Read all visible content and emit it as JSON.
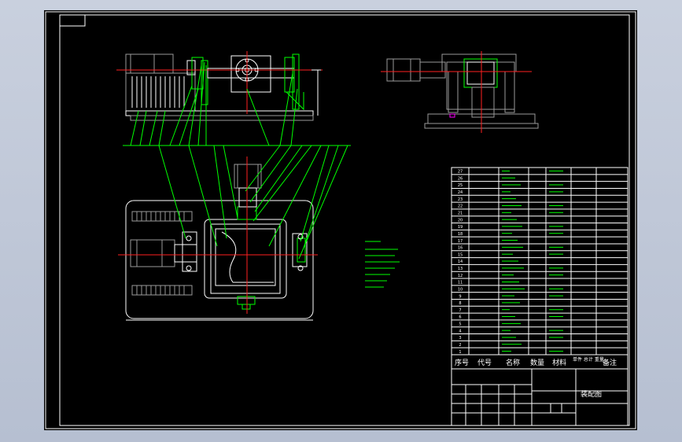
{
  "drawing": {
    "title_block": {
      "header": {
        "seq": "序号",
        "code": "代号",
        "name": "名称",
        "qty": "数量",
        "material": "材料",
        "weight": "单件 总计 重量",
        "remark": "备注"
      },
      "drawing_name": "装配图"
    },
    "parts_list_numbers": [
      "27",
      "26",
      "25",
      "24",
      "23",
      "22",
      "21",
      "20",
      "19",
      "18",
      "17",
      "16",
      "15",
      "14",
      "13",
      "12",
      "11",
      "10",
      "9",
      "8",
      "7",
      "6",
      "5",
      "4",
      "3",
      "2",
      "1"
    ]
  },
  "colors": {
    "sheet": "#000000",
    "outline": "#ffffff",
    "lines": "#00ff00",
    "centerline": "#ff2020",
    "background": "#c3cad9"
  }
}
